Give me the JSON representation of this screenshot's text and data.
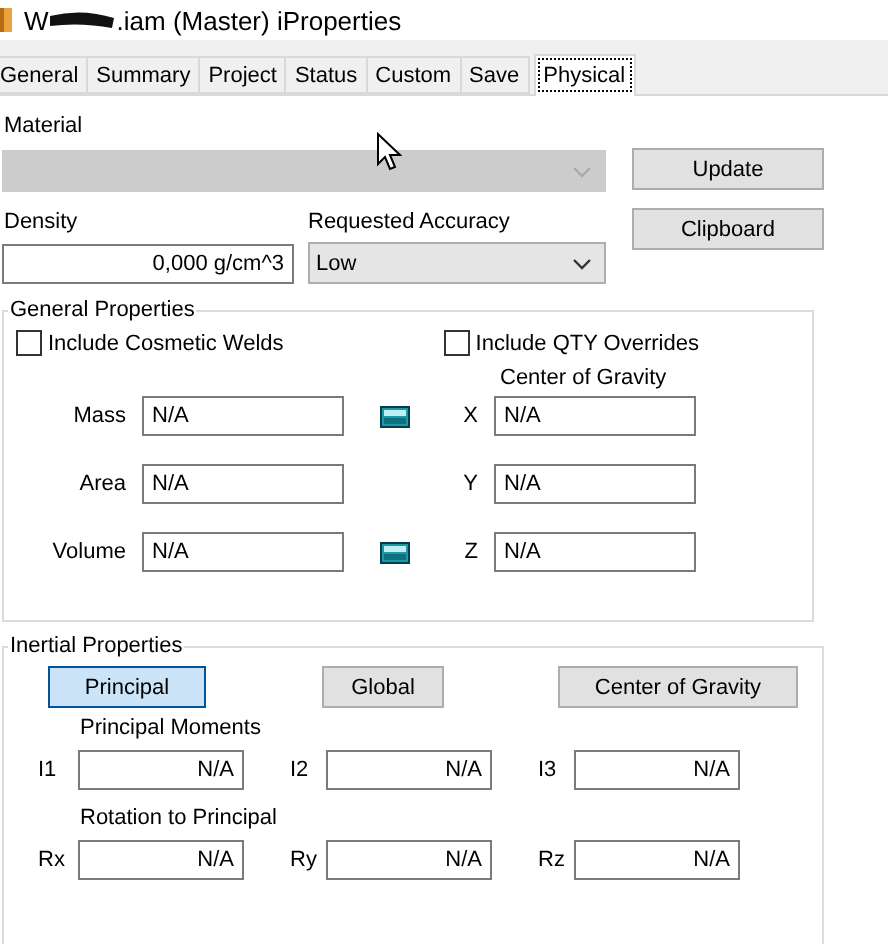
{
  "window": {
    "title_start": "W",
    "title_end": ".iam (Master) iProperties"
  },
  "tabs": [
    {
      "label": "General",
      "selected": false
    },
    {
      "label": "Summary",
      "selected": false
    },
    {
      "label": "Project",
      "selected": false
    },
    {
      "label": "Status",
      "selected": false
    },
    {
      "label": "Custom",
      "selected": false
    },
    {
      "label": "Save",
      "selected": false
    },
    {
      "label": "Physical",
      "selected": true
    }
  ],
  "material": {
    "label": "Material",
    "disabled": true
  },
  "buttons": [
    {
      "label": "Update"
    },
    {
      "label": "Clipboard"
    }
  ],
  "density": {
    "label": "Density",
    "value": "0,000 g/cm^3"
  },
  "accuracy": {
    "label": "Requested Accuracy",
    "value": "Low"
  },
  "general_properties": {
    "title": "General Properties",
    "checkboxes": [
      {
        "label": "Include Cosmetic Welds",
        "checked": false
      },
      {
        "label": "Include QTY Overrides",
        "checked": false
      }
    ],
    "cog_heading": "Center of Gravity",
    "rows": [
      {
        "label": "Mass",
        "value": "N/A",
        "calculator": true,
        "axis": "X",
        "axis_value": "N/A"
      },
      {
        "label": "Area",
        "value": "N/A",
        "calculator": false,
        "axis": "Y",
        "axis_value": "N/A"
      },
      {
        "label": "Volume",
        "value": "N/A",
        "calculator": true,
        "axis": "Z",
        "axis_value": "N/A"
      }
    ]
  },
  "inertial_properties": {
    "title": "Inertial Properties",
    "buttons": [
      {
        "label": "Principal",
        "selected": true
      },
      {
        "label": "Global",
        "selected": false
      },
      {
        "label": "Center of Gravity",
        "selected": false
      }
    ],
    "moments_heading": "Principal Moments",
    "moments": [
      {
        "label": "I1",
        "value": "N/A"
      },
      {
        "label": "I2",
        "value": "N/A"
      },
      {
        "label": "I3",
        "value": "N/A"
      }
    ],
    "rotation_heading": "Rotation to Principal",
    "rotations": [
      {
        "label": "Rx",
        "value": "N/A"
      },
      {
        "label": "Ry",
        "value": "N/A"
      },
      {
        "label": "Rz",
        "value": "N/A"
      }
    ]
  }
}
